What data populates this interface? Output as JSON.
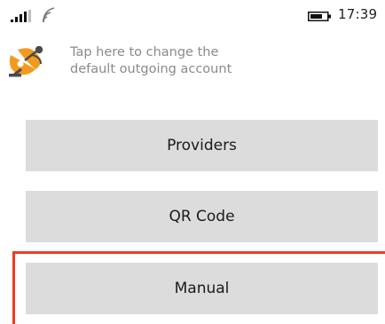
{
  "status_bar": {
    "signal_icon": "signal-bars-icon",
    "wifi_icon": "wifi-icon",
    "battery_icon": "battery-icon",
    "time": "17:39"
  },
  "account": {
    "icon": "mail-satellite-icon",
    "line1": "Tap here to change the",
    "line2": "default outgoing account"
  },
  "buttons": {
    "providers": "Providers",
    "qr_code": "QR Code",
    "manual": "Manual"
  },
  "colors": {
    "accent_orange": "#f39a1e",
    "highlight_red": "#ee3b24",
    "button_bg": "#dcdcdc"
  }
}
